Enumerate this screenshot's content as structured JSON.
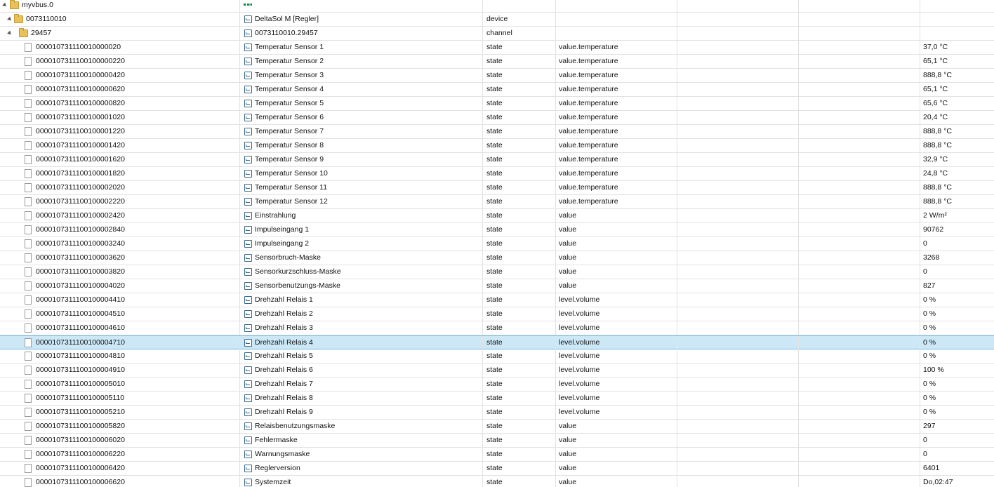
{
  "rows": [
    {
      "id": "myvbus.0",
      "name": "",
      "type": "",
      "role": "",
      "value": "",
      "depth": 0,
      "node": "folder",
      "expanded": true,
      "icon": "vbus-logo-icon"
    },
    {
      "id": "0073110010",
      "name": "DeltaSol M [Regler]",
      "type": "device",
      "role": "",
      "value": "",
      "depth": 1,
      "node": "folder",
      "expanded": true,
      "icon": "device-icon"
    },
    {
      "id": "29457",
      "name": "0073110010.29457",
      "type": "channel",
      "role": "",
      "value": "",
      "depth": 2,
      "node": "folder",
      "expanded": true,
      "icon": "channel-icon"
    },
    {
      "id": "00001073111001000002 0",
      "name": "Temperatur Sensor 1",
      "type": "state",
      "role": "value.temperature",
      "value": "37,0 °C",
      "depth": 3,
      "node": "file"
    },
    {
      "id": "0000107311100100000220",
      "name": "Temperatur Sensor 2",
      "type": "state",
      "role": "value.temperature",
      "value": "65,1 °C",
      "depth": 3,
      "node": "file"
    },
    {
      "id": "0000107311100100000420",
      "name": "Temperatur Sensor 3",
      "type": "state",
      "role": "value.temperature",
      "value": "888,8 °C",
      "depth": 3,
      "node": "file"
    },
    {
      "id": "0000107311100100000620",
      "name": "Temperatur Sensor 4",
      "type": "state",
      "role": "value.temperature",
      "value": "65,1 °C",
      "depth": 3,
      "node": "file"
    },
    {
      "id": "0000107311100100000820",
      "name": "Temperatur Sensor 5",
      "type": "state",
      "role": "value.temperature",
      "value": "65,6 °C",
      "depth": 3,
      "node": "file"
    },
    {
      "id": "0000107311100100001020",
      "name": "Temperatur Sensor 6",
      "type": "state",
      "role": "value.temperature",
      "value": "20,4 °C",
      "depth": 3,
      "node": "file"
    },
    {
      "id": "0000107311100100001220",
      "name": "Temperatur Sensor 7",
      "type": "state",
      "role": "value.temperature",
      "value": "888,8 °C",
      "depth": 3,
      "node": "file"
    },
    {
      "id": "0000107311100100001420",
      "name": "Temperatur Sensor 8",
      "type": "state",
      "role": "value.temperature",
      "value": "888,8 °C",
      "depth": 3,
      "node": "file"
    },
    {
      "id": "0000107311100100001620",
      "name": "Temperatur Sensor 9",
      "type": "state",
      "role": "value.temperature",
      "value": "32,9 °C",
      "depth": 3,
      "node": "file"
    },
    {
      "id": "0000107311100100001820",
      "name": "Temperatur Sensor 10",
      "type": "state",
      "role": "value.temperature",
      "value": "24,8 °C",
      "depth": 3,
      "node": "file"
    },
    {
      "id": "0000107311100100002020",
      "name": "Temperatur Sensor 11",
      "type": "state",
      "role": "value.temperature",
      "value": "888,8 °C",
      "depth": 3,
      "node": "file"
    },
    {
      "id": "0000107311100100002220",
      "name": "Temperatur Sensor 12",
      "type": "state",
      "role": "value.temperature",
      "value": "888,8 °C",
      "depth": 3,
      "node": "file"
    },
    {
      "id": "0000107311100100002420",
      "name": "Einstrahlung",
      "type": "state",
      "role": "value",
      "value": "2 W/m²",
      "depth": 3,
      "node": "file"
    },
    {
      "id": "0000107311100100002840",
      "name": "Impulseingang 1",
      "type": "state",
      "role": "value",
      "value": "90762",
      "depth": 3,
      "node": "file"
    },
    {
      "id": "0000107311100100003240",
      "name": "Impulseingang 2",
      "type": "state",
      "role": "value",
      "value": "0",
      "depth": 3,
      "node": "file"
    },
    {
      "id": "0000107311100100003620",
      "name": "Sensorbruch-Maske",
      "type": "state",
      "role": "value",
      "value": "3268",
      "depth": 3,
      "node": "file"
    },
    {
      "id": "0000107311100100003820",
      "name": "Sensorkurzschluss-Maske",
      "type": "state",
      "role": "value",
      "value": "0",
      "depth": 3,
      "node": "file"
    },
    {
      "id": "0000107311100100004020",
      "name": "Sensorbenutzungs-Maske",
      "type": "state",
      "role": "value",
      "value": "827",
      "depth": 3,
      "node": "file"
    },
    {
      "id": "0000107311100100004410",
      "name": "Drehzahl Relais 1",
      "type": "state",
      "role": "level.volume",
      "value": "0 %",
      "depth": 3,
      "node": "file"
    },
    {
      "id": "0000107311100100004510",
      "name": "Drehzahl Relais 2",
      "type": "state",
      "role": "level.volume",
      "value": "0 %",
      "depth": 3,
      "node": "file"
    },
    {
      "id": "0000107311100100004610",
      "name": "Drehzahl Relais 3",
      "type": "state",
      "role": "level.volume",
      "value": "0 %",
      "depth": 3,
      "node": "file"
    },
    {
      "id": "0000107311100100004710",
      "name": "Drehzahl Relais 4",
      "type": "state",
      "role": "level.volume",
      "value": "0 %",
      "depth": 3,
      "node": "file",
      "selected": true
    },
    {
      "id": "0000107311100100004810",
      "name": "Drehzahl Relais 5",
      "type": "state",
      "role": "level.volume",
      "value": "0 %",
      "depth": 3,
      "node": "file"
    },
    {
      "id": "0000107311100100004910",
      "name": "Drehzahl Relais 6",
      "type": "state",
      "role": "level.volume",
      "value": "100 %",
      "depth": 3,
      "node": "file"
    },
    {
      "id": "0000107311100100005010",
      "name": "Drehzahl Relais 7",
      "type": "state",
      "role": "level.volume",
      "value": "0 %",
      "depth": 3,
      "node": "file"
    },
    {
      "id": "0000107311100100005110",
      "name": "Drehzahl Relais 8",
      "type": "state",
      "role": "level.volume",
      "value": "0 %",
      "depth": 3,
      "node": "file"
    },
    {
      "id": "0000107311100100005210",
      "name": "Drehzahl Relais 9",
      "type": "state",
      "role": "level.volume",
      "value": "0 %",
      "depth": 3,
      "node": "file"
    },
    {
      "id": "0000107311100100005820",
      "name": "Relaisbenutzungsmaske",
      "type": "state",
      "role": "value",
      "value": "297",
      "depth": 3,
      "node": "file"
    },
    {
      "id": "0000107311100100006020",
      "name": "Fehlermaske",
      "type": "state",
      "role": "value",
      "value": "0",
      "depth": 3,
      "node": "file"
    },
    {
      "id": "0000107311100100006220",
      "name": "Warnungsmaske",
      "type": "state",
      "role": "value",
      "value": "0",
      "depth": 3,
      "node": "file"
    },
    {
      "id": "0000107311100100006420",
      "name": "Reglerversion",
      "type": "state",
      "role": "value",
      "value": "6401",
      "depth": 3,
      "node": "file"
    },
    {
      "id": "0000107311100100006620",
      "name": "Systemzeit",
      "type": "state",
      "role": "value",
      "value": "Do,02:47",
      "depth": 3,
      "node": "file"
    }
  ]
}
